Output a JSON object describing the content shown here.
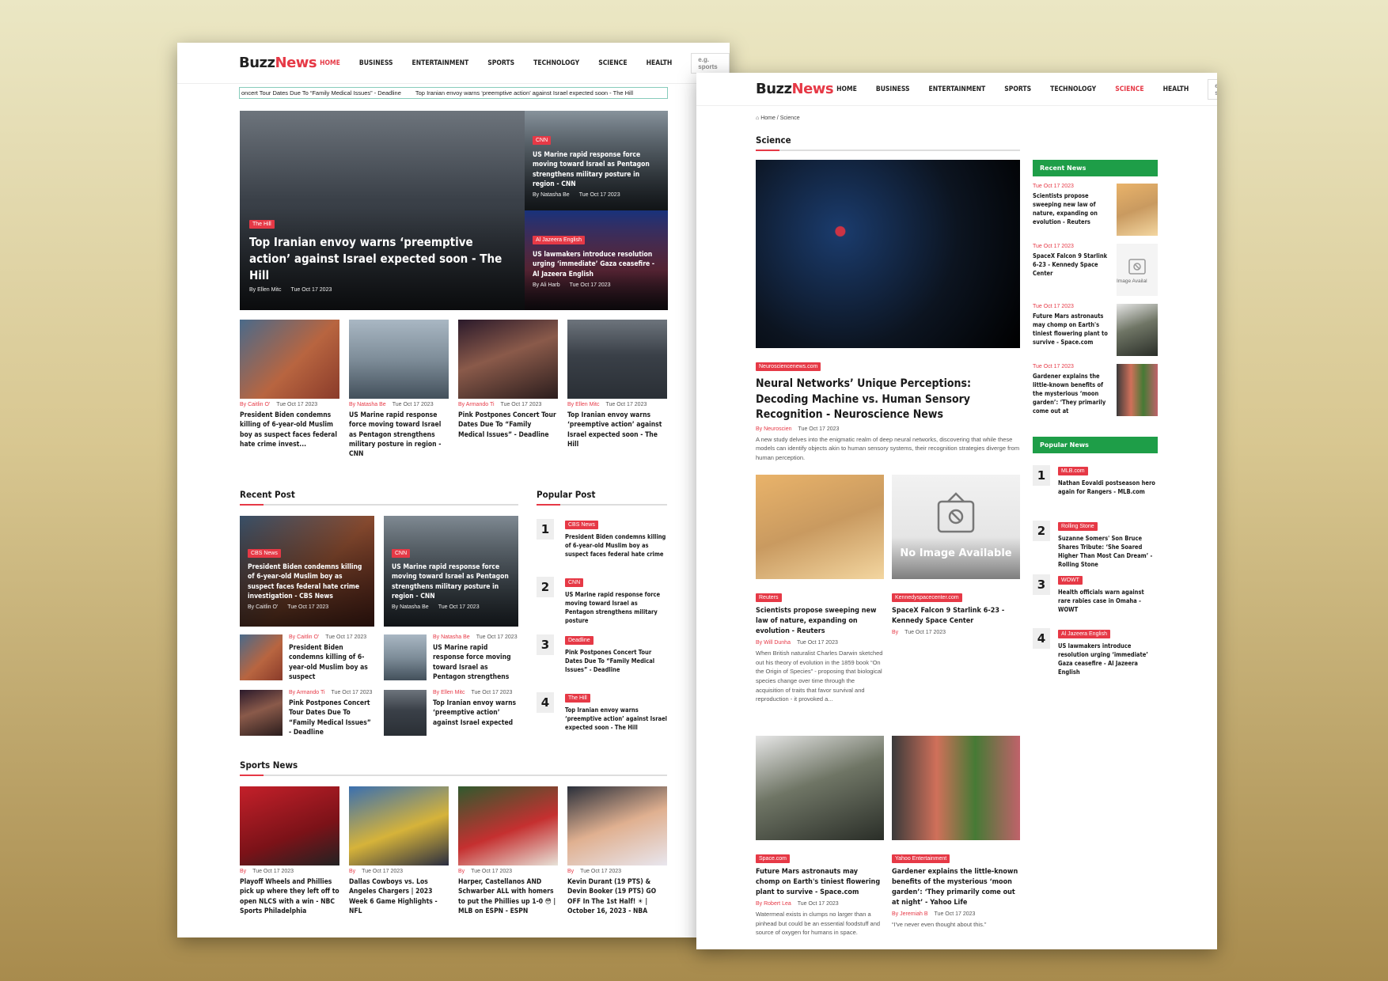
{
  "logo": {
    "part1": "Buzz",
    "part2": "News"
  },
  "nav": [
    "HOME",
    "BUSINESS",
    "ENTERTAINMENT",
    "SPORTS",
    "TECHNOLOGY",
    "SCIENCE",
    "HEALTH"
  ],
  "search_placeholder": "e.g. sports",
  "ticker": [
    "oncert Tour Dates Due To “Family Medical Issues” - Deadline",
    "Top Iranian envoy warns ‘preemptive action’ against Israel expected soon - The Hill"
  ],
  "hero": {
    "main": {
      "tag": "The Hill",
      "title": "Top Iranian envoy warns ‘preemptive action’ against Israel expected soon - The Hill",
      "author": "By Ellen Mitc",
      "date": "Tue Oct 17 2023"
    },
    "side1": {
      "tag": "CNN",
      "title": "US Marine rapid response force moving toward Israel as Pentagon strengthens military posture in region - CNN",
      "author": "By Natasha Be",
      "date": "Tue Oct 17 2023"
    },
    "side2": {
      "tag": "Al Jazeera English",
      "title": "US lawmakers introduce resolution urging ‘immediate’ Gaza ceasefire - Al Jazeera English",
      "author": "By Ali Harb",
      "date": "Tue Oct 17 2023"
    }
  },
  "grid": [
    {
      "author": "By Caitlin O'",
      "date": "Tue Oct 17 2023",
      "title": "President Biden condemns killing of 6-year-old Muslim boy as suspect faces federal hate crime invest..."
    },
    {
      "author": "By Natasha Be",
      "date": "Tue Oct 17 2023",
      "title": "US Marine rapid response force moving toward Israel as Pentagon strengthens military posture in region - CNN"
    },
    {
      "author": "By Armando Ti",
      "date": "Tue Oct 17 2023",
      "title": "Pink Postpones Concert Tour Dates Due To “Family Medical Issues” - Deadline"
    },
    {
      "author": "By Ellen Mitc",
      "date": "Tue Oct 17 2023",
      "title": "Top Iranian envoy warns ‘preemptive action’ against Israel expected soon - The Hill"
    }
  ],
  "recent_post": {
    "heading": "Recent Post",
    "big": [
      {
        "tag": "CBS News",
        "title": "President Biden condemns killing of 6-year-old Muslim boy as suspect faces federal hate crime investigation - CBS News",
        "author": "By Caitlin O'",
        "date": "Tue Oct 17 2023"
      },
      {
        "tag": "CNN",
        "title": "US Marine rapid response force moving toward Israel as Pentagon strengthens military posture in region - CNN",
        "author": "By Natasha Be",
        "date": "Tue Oct 17 2023"
      }
    ],
    "small": [
      {
        "author": "By Caitlin O'",
        "date": "Tue Oct 17 2023",
        "title": "President Biden condemns killing of 6-year-old Muslim boy as suspect"
      },
      {
        "author": "By Natasha Be",
        "date": "Tue Oct 17 2023",
        "title": "US Marine rapid response force moving toward Israel as Pentagon strengthens"
      },
      {
        "author": "By Armando Ti",
        "date": "Tue Oct 17 2023",
        "title": "Pink Postpones Concert Tour Dates Due To “Family Medical Issues” - Deadline"
      },
      {
        "author": "By Ellen Mitc",
        "date": "Tue Oct 17 2023",
        "title": "Top Iranian envoy warns ‘preemptive action’ against Israel expected"
      }
    ]
  },
  "popular_post": {
    "heading": "Popular Post",
    "items": [
      {
        "num": "1",
        "tag": "CBS News",
        "title": "President Biden condemns killing of 6-year-old Muslim boy as suspect faces federal hate crime"
      },
      {
        "num": "2",
        "tag": "CNN",
        "title": "US Marine rapid response force moving toward Israel as Pentagon strengthens military posture"
      },
      {
        "num": "3",
        "tag": "Deadline",
        "title": "Pink Postpones Concert Tour Dates Due To “Family Medical Issues” - Deadline"
      },
      {
        "num": "4",
        "tag": "The Hill",
        "title": "Top Iranian envoy warns ‘preemptive action’ against Israel expected soon - The Hill"
      }
    ]
  },
  "sports": {
    "heading": "Sports News",
    "items": [
      {
        "author": "By",
        "date": "Tue Oct 17 2023",
        "title": "Playoff Wheels and Phillies pick up where they left off to open NLCS with a win - NBC Sports Philadelphia"
      },
      {
        "author": "By",
        "date": "Tue Oct 17 2023",
        "title": "Dallas Cowboys vs. Los Angeles Chargers | 2023 Week 6 Game Highlights - NFL"
      },
      {
        "author": "By",
        "date": "Tue Oct 17 2023",
        "title": "Harper, Castellanos AND Schwarber ALL with homers to put the Phillies up 1-0 😳 | MLB on ESPN - ESPN"
      },
      {
        "author": "By",
        "date": "Tue Oct 17 2023",
        "title": "Kevin Durant (19 PTS) & Devin Booker (19 PTS) GO OFF In The 1st Half! ☀ | October 16, 2023 - NBA"
      }
    ]
  },
  "science_page": {
    "breadcrumb": "Home / Science",
    "heading": "Science",
    "feature": {
      "tag": "Neurosciencenews.com",
      "title": "Neural Networks’ Unique Perceptions: Decoding Machine vs. Human Sensory Recognition - Neuroscience News",
      "author": "By Neuroscien",
      "date": "Tue Oct 17 2023",
      "excerpt": "A new study delves into the enigmatic realm of deep neural networks, discovering that while these models can identify objects akin to human sensory systems, their recognition strategies diverge from human perception."
    },
    "cards": [
      {
        "tag": "Reuters",
        "title": "Scientists propose sweeping new law of nature, expanding on evolution - Reuters",
        "author": "By Will Dunha",
        "date": "Tue Oct 17 2023",
        "excerpt": "When British naturalist Charles Darwin sketched out his theory of evolution in the 1859 book “On the Origin of Species” - proposing that biological species change over time through the acquisition of traits that favor survival and reproduction - it provoked a..."
      },
      {
        "tag": "Kennedyspacecenter.com",
        "title": "SpaceX Falcon 9 Starlink 6-23 - Kennedy Space Center",
        "author": "By",
        "date": "Tue Oct 17 2023",
        "excerpt": ""
      },
      {
        "tag": "Space.com",
        "title": "Future Mars astronauts may chomp on Earth's tiniest flowering plant to survive - Space.com",
        "author": "By Robert Lea",
        "date": "Tue Oct 17 2023",
        "excerpt": "Watermeal exists in clumps no larger than a pinhead but could be an essential foodstuff and source of oxygen for humans in space."
      },
      {
        "tag": "Yahoo Entertainment",
        "title": "Gardener explains the little-known benefits of the mysterious ‘moon garden’: ‘They primarily come out at night’ - Yahoo Life",
        "author": "By Jeremiah B",
        "date": "Tue Oct 17 2023",
        "excerpt": "“I've never even thought about this.”"
      }
    ],
    "no_image": "No Image Available",
    "recent_heading": "Recent News",
    "recent": [
      {
        "date": "Tue Oct 17 2023",
        "title": "Scientists propose sweeping new law of nature, expanding on evolution - Reuters"
      },
      {
        "date": "Tue Oct 17 2023",
        "title": "SpaceX Falcon 9 Starlink 6-23 - Kennedy Space Center",
        "img_text": "Image Availal"
      },
      {
        "date": "Tue Oct 17 2023",
        "title": "Future Mars astronauts may chomp on Earth's tiniest flowering plant to survive - Space.com"
      },
      {
        "date": "Tue Oct 17 2023",
        "title": "Gardener explains the little-known benefits of the mysterious ‘moon garden’: ‘They primarily come out at"
      }
    ],
    "popular_heading": "Popular News",
    "popular": [
      {
        "num": "1",
        "tag": "MLB.com",
        "title": "Nathan Eovaldi postseason hero again for Rangers - MLB.com"
      },
      {
        "num": "2",
        "tag": "Rolling Stone",
        "title": "Suzanne Somers' Son Bruce Shares Tribute: ‘She Soared Higher Than Most Can Dream’ - Rolling Stone"
      },
      {
        "num": "3",
        "tag": "WOWT",
        "title": "Health officials warn against rare rabies case in Omaha - WOWT"
      },
      {
        "num": "4",
        "tag": "Al Jazeera English",
        "title": "US lawmakers introduce resolution urging ‘immediate’ Gaza ceasefire - Al Jazeera English"
      }
    ]
  },
  "colors": {
    "accent": "#e63946",
    "green": "#1e9e48"
  }
}
